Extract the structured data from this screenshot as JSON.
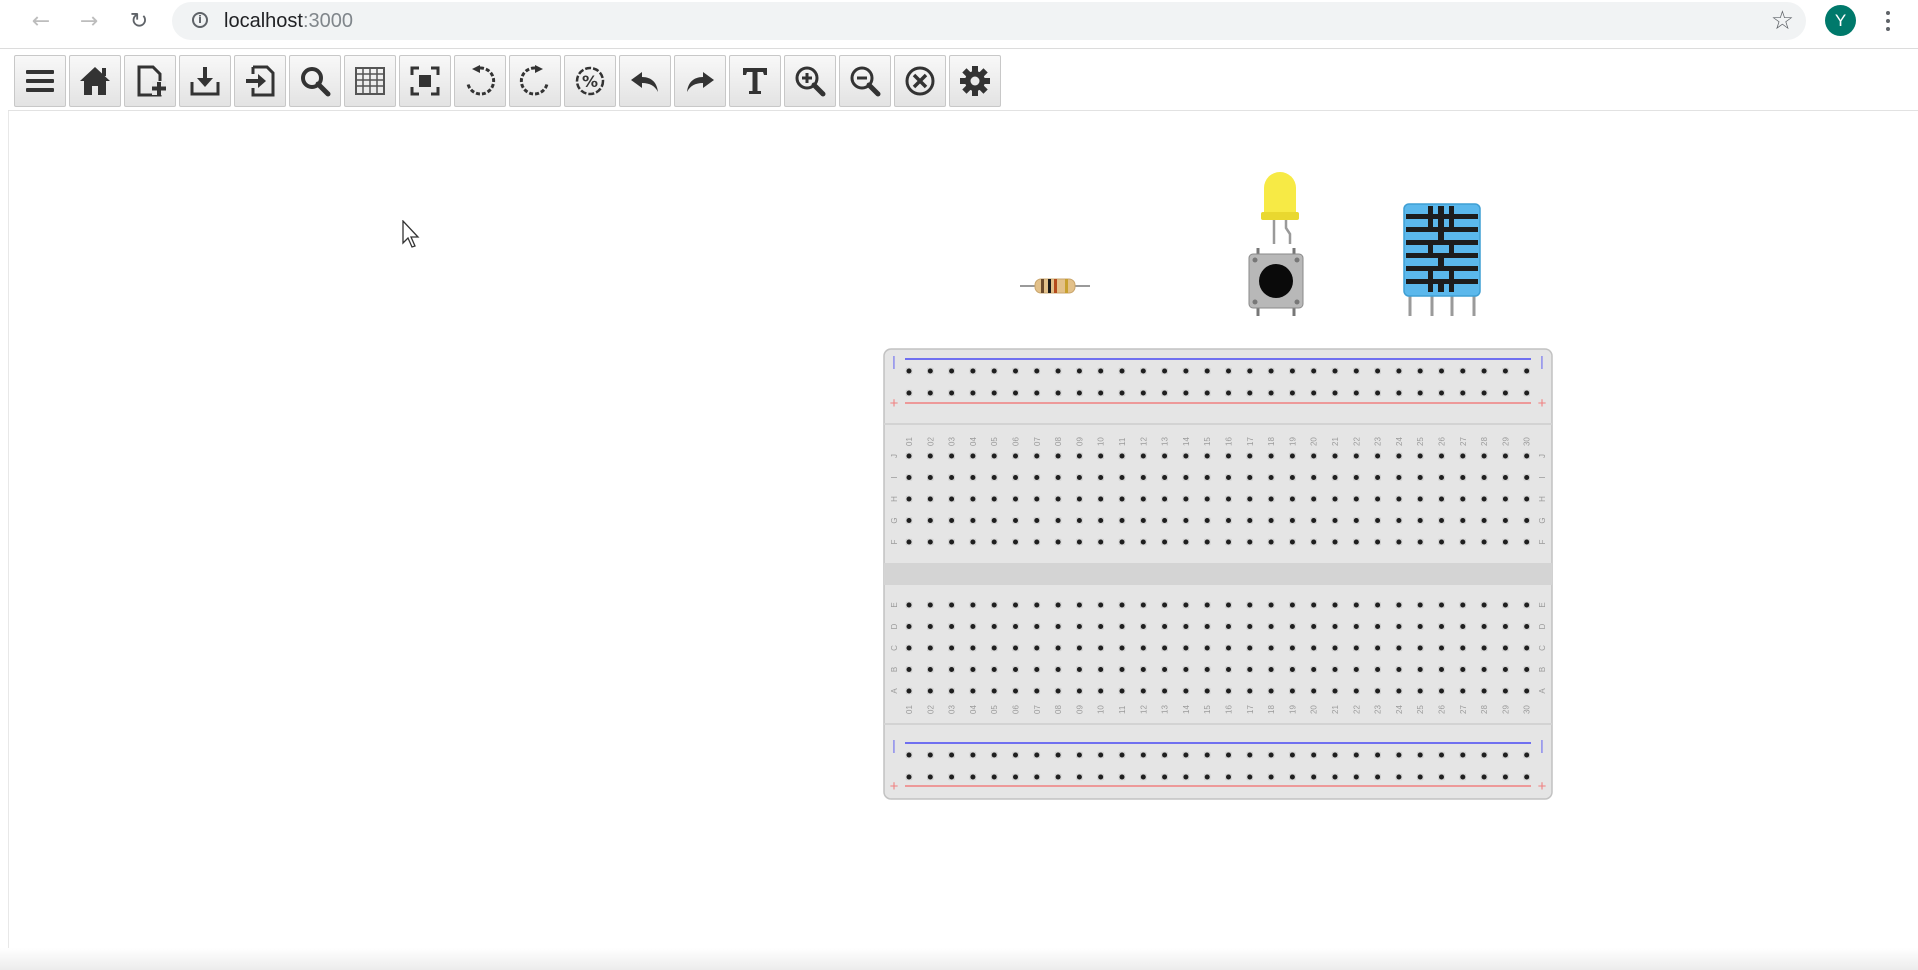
{
  "browser": {
    "back_icon": "back-arrow-icon",
    "forward_icon": "forward-arrow-icon",
    "reload_icon": "reload-icon",
    "address_host": "localhost",
    "address_port": ":3000",
    "avatar_initial": "Y",
    "avatar_color": "#00796b"
  },
  "toolbar": {
    "buttons": [
      {
        "icon": "menu-icon"
      },
      {
        "icon": "home-icon"
      },
      {
        "icon": "new-file-icon"
      },
      {
        "icon": "download-icon"
      },
      {
        "icon": "import-icon"
      },
      {
        "icon": "search-icon"
      },
      {
        "icon": "grid-icon"
      },
      {
        "icon": "fit-to-screen-icon"
      },
      {
        "icon": "rotate-left-icon"
      },
      {
        "icon": "rotate-right-icon"
      },
      {
        "icon": "zoom-reset-icon"
      },
      {
        "icon": "undo-icon"
      },
      {
        "icon": "redo-icon"
      },
      {
        "icon": "text-icon"
      },
      {
        "icon": "zoom-in-icon"
      },
      {
        "icon": "zoom-out-icon"
      },
      {
        "icon": "delete-icon"
      },
      {
        "icon": "settings-icon"
      }
    ]
  },
  "canvas": {
    "components": [
      "resistor",
      "yellow-led",
      "push-button",
      "dht11-sensor",
      "breadboard"
    ],
    "colors": {
      "led": "#f5e642",
      "sensor": "#5bb8ec",
      "rail_blue": "#7070f0",
      "rail_red": "#f08080"
    }
  },
  "breadboard": {
    "column_labels": [
      "01",
      "02",
      "03",
      "04",
      "05",
      "06",
      "07",
      "08",
      "09",
      "10",
      "11",
      "12",
      "13",
      "14",
      "15",
      "16",
      "17",
      "18",
      "19",
      "20",
      "21",
      "22",
      "23",
      "24",
      "25",
      "26",
      "27",
      "28",
      "29",
      "30"
    ],
    "top_rows": [
      "J",
      "I",
      "H",
      "G",
      "F"
    ],
    "bottom_rows": [
      "E",
      "D",
      "C",
      "B",
      "A"
    ],
    "rail_minus": "|",
    "rail_plus": "+"
  }
}
